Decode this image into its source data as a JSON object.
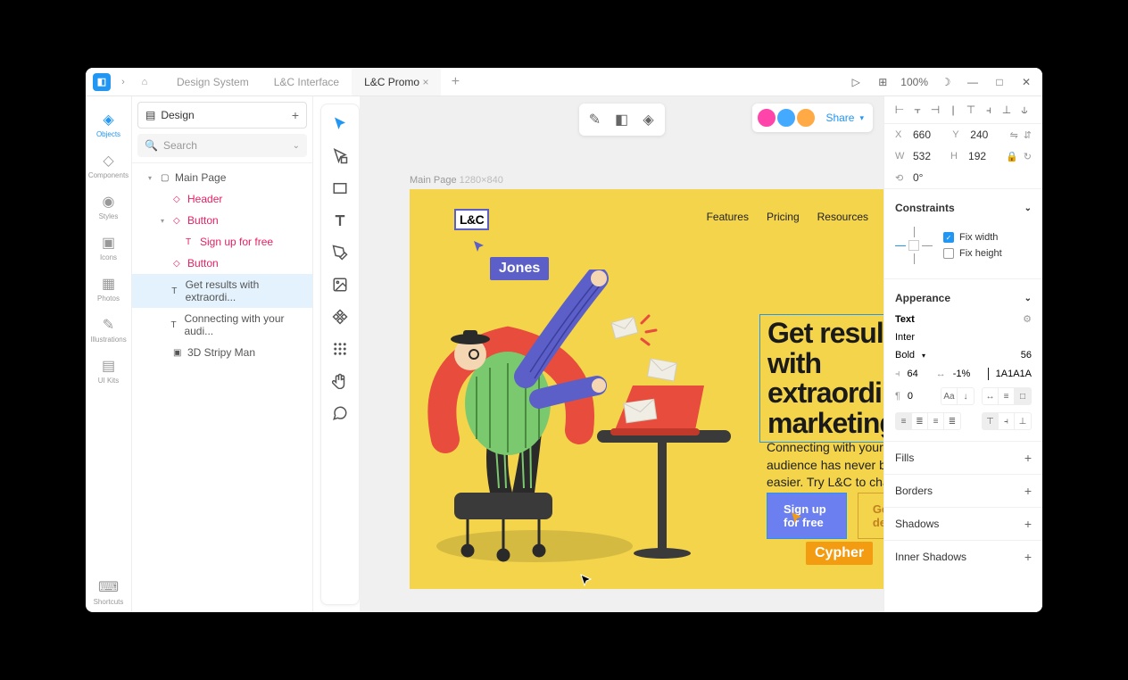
{
  "titlebar": {
    "tabs": [
      "Design System",
      "L&C Interface",
      "L&C Promo"
    ],
    "activeTab": 2,
    "zoom": "100%"
  },
  "rail": {
    "items": [
      {
        "label": "Objects",
        "icon": "◈"
      },
      {
        "label": "Components",
        "icon": "◇"
      },
      {
        "label": "Styles",
        "icon": "◉"
      },
      {
        "label": "Icons",
        "icon": "▣"
      },
      {
        "label": "Photos",
        "icon": "▦"
      },
      {
        "label": "Illustrations",
        "icon": "✎"
      },
      {
        "label": "UI Kits",
        "icon": "▤"
      }
    ],
    "bottom": {
      "label": "Shortcuts",
      "icon": "⌨"
    }
  },
  "layers": {
    "design": "Design",
    "searchPlaceholder": "Search",
    "tree": [
      {
        "label": "Main Page",
        "indent": 0,
        "arrow": "▾",
        "icon": "▢"
      },
      {
        "label": "Header",
        "indent": 1,
        "icon": "◇",
        "pink": true
      },
      {
        "label": "Button",
        "indent": 1,
        "arrow": "▾",
        "icon": "◇",
        "pink": true
      },
      {
        "label": "Sign up for free",
        "indent": 2,
        "icon": "T",
        "pink": true
      },
      {
        "label": "Button",
        "indent": 1,
        "icon": "◇",
        "pink": true
      },
      {
        "label": "Get results with extraordi...",
        "indent": 1,
        "icon": "T",
        "selected": true
      },
      {
        "label": "Connecting with your audi...",
        "indent": 1,
        "icon": "T"
      },
      {
        "label": "3D Stripy Man",
        "indent": 1,
        "icon": "▣"
      }
    ]
  },
  "canvas": {
    "frameLabel": "Main Page",
    "frameSize": "1280×840",
    "logo": "L&C",
    "nav": [
      "Features",
      "Pricing",
      "Resources"
    ],
    "jones": "Jones",
    "cypher": "Cypher",
    "heading": "Get results with extraordinary marketing",
    "subhead": "Connecting with your audience has never been easier. Try L&C to change your game.",
    "ctaPrimary": "Sign up for free",
    "ctaSecondary": "Get a demo",
    "share": "Share"
  },
  "inspector": {
    "x": "660",
    "y": "240",
    "w": "532",
    "h": "192",
    "rotation": "0°",
    "constraints": "Constraints",
    "fixWidth": "Fix width",
    "fixHeight": "Fix height",
    "appearance": "Apperance",
    "textLabel": "Text",
    "fontFamily": "Inter",
    "fontWeight": "Bold",
    "fontSize": "56",
    "lineHeight": "64",
    "letterSpacing": "-1%",
    "colorHex": "1A1A1A",
    "paragraph": "0",
    "fills": "Fills",
    "borders": "Borders",
    "shadows": "Shadows",
    "innerShadows": "Inner Shadows"
  }
}
